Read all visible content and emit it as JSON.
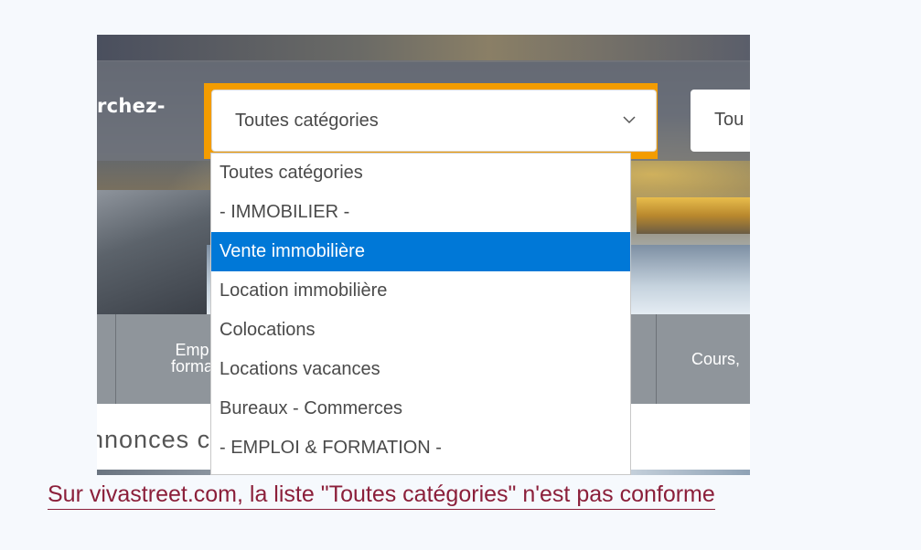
{
  "search_label": "rchez-",
  "category_select": {
    "value": "Toutes catégories"
  },
  "location_select": {
    "value": "Tou"
  },
  "dropdown": {
    "options": [
      "Toutes catégories",
      "- IMMOBILIER -",
      "Vente immobilière",
      "Location immobilière",
      "Colocations",
      "Locations vacances",
      "Bureaux - Commerces",
      "- EMPLOI & FORMATION -"
    ],
    "highlighted": "Vente immobilière"
  },
  "nav": {
    "item_emploi_line1": "Emp",
    "item_emploi_line2": "forma",
    "item_cours": "Cours,"
  },
  "annonces_text": "nnonces c",
  "caption": "Sur vivastreet.com, la liste \"Toutes catégories\" n'est pas conforme",
  "colors": {
    "focus_outline": "#f39c00",
    "highlight": "#0078d7",
    "caption": "#8b1f3a"
  }
}
